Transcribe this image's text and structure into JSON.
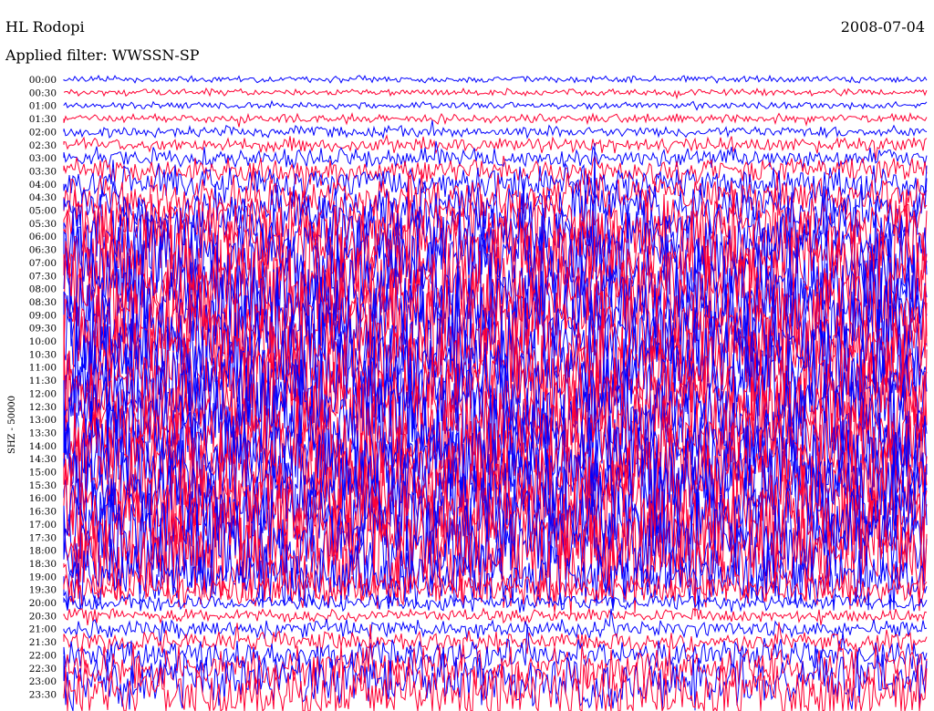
{
  "header": {
    "station": "HL Rodopi",
    "date": "2008-07-04",
    "filter_label": "Applied filter: WWSSN-SP"
  },
  "chart_data": {
    "type": "line",
    "title": "HL Rodopi",
    "subtitle": "Applied filter: WWSSN-SP",
    "ylabel": "SHZ - 50000",
    "trace_colors": [
      "#0000ff",
      "#ff0033"
    ],
    "row_labels": [
      "00:00",
      "00:30",
      "01:00",
      "01:30",
      "02:00",
      "02:30",
      "03:00",
      "03:30",
      "04:00",
      "04:30",
      "05:00",
      "05:30",
      "06:00",
      "06:30",
      "07:00",
      "07:30",
      "08:00",
      "08:30",
      "09:00",
      "09:30",
      "10:00",
      "10:30",
      "11:00",
      "11:30",
      "12:00",
      "12:30",
      "13:00",
      "13:30",
      "14:00",
      "14:30",
      "15:00",
      "15:30",
      "16:00",
      "16:30",
      "17:00",
      "17:30",
      "18:00",
      "18:30",
      "19:00",
      "19:30",
      "20:00",
      "20:30",
      "21:00",
      "21:30",
      "22:00",
      "22:30",
      "23:00",
      "23:30"
    ],
    "activity": [
      0.03,
      0.03,
      0.03,
      0.04,
      0.05,
      0.07,
      0.09,
      0.12,
      0.16,
      0.2,
      0.25,
      0.3,
      0.36,
      0.42,
      0.48,
      0.5,
      0.5,
      0.5,
      0.5,
      0.5,
      0.5,
      0.5,
      0.5,
      0.5,
      0.5,
      0.5,
      0.5,
      0.5,
      0.5,
      0.5,
      0.5,
      0.5,
      0.5,
      0.5,
      0.5,
      0.5,
      0.5,
      0.45,
      0.3,
      0.15,
      0.08,
      0.06,
      0.08,
      0.1,
      0.14,
      0.2,
      0.25,
      0.3
    ]
  }
}
